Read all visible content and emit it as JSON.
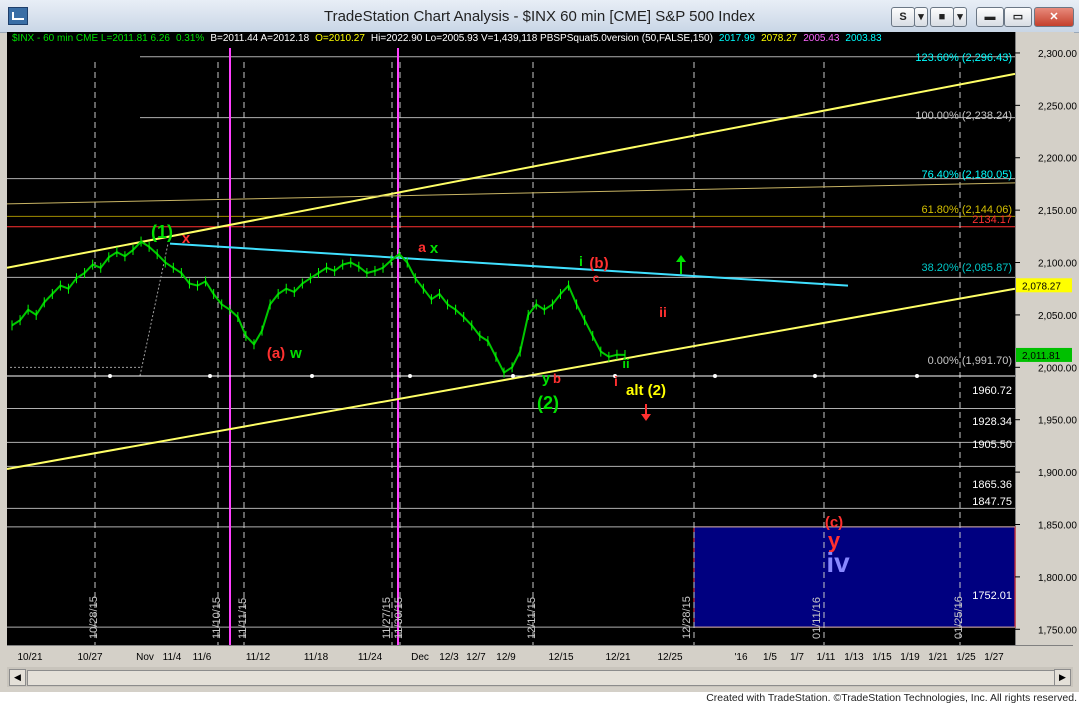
{
  "window": {
    "title": "TradeStation Chart Analysis - $INX 60 min [CME] S&P 500 Index"
  },
  "titlebar_buttons": {
    "s": "S",
    "dropdown": "▾",
    "stop": "■",
    "minimize": "▬",
    "maximize": "▭",
    "close": "✕"
  },
  "status_bar": [
    {
      "text": "$INX - 60 min  CME  L=2011.81  6.26",
      "color": "#00e000"
    },
    {
      "text": "0.31%",
      "color": "#00e000"
    },
    {
      "text": "B=2011.44  A=2012.18",
      "color": "#ffffff"
    },
    {
      "text": "O=2010.27",
      "color": "#ffff00"
    },
    {
      "text": "Hi=2022.90  Lo=2005.93  V=1,439,118  PBSPSquat5.0version (50,FALSE,150)",
      "color": "#ffffff"
    },
    {
      "text": "2017.99",
      "color": "#00ffff"
    },
    {
      "text": "2078.27",
      "color": "#ffff00"
    },
    {
      "text": "2005.43",
      "color": "#ff66ff"
    },
    {
      "text": "2003.83",
      "color": "#00ffff"
    }
  ],
  "price_axis": {
    "labels": [
      "2,300.00",
      "2,250.00",
      "2,200.00",
      "2,150.00",
      "2,100.00",
      "2,050.00",
      "2,000.00",
      "1,950.00",
      "1,900.00",
      "1,850.00",
      "1,800.00",
      "1,750.00"
    ],
    "highlights": [
      {
        "text": "2,078.27",
        "bg": "#ffff00",
        "fg": "#000000"
      },
      {
        "text": "2,011.81",
        "bg": "#00c000",
        "fg": "#000000"
      }
    ]
  },
  "fib_labels": [
    {
      "text": "123.60% (2,296.43)",
      "color": "#00ffff"
    },
    {
      "text": "100.00% (2,238.24)",
      "color": "#c8c8c8"
    },
    {
      "text": "76.40% (2,180.05)",
      "color": "#00ffff"
    },
    {
      "text": "61.80% (2,144.06)",
      "color": "#d4c000"
    },
    {
      "text": "38.20% (2,085.87)",
      "color": "#00c8c8"
    },
    {
      "text": "0.00% (1,991.70)",
      "color": "#c8c8c8"
    }
  ],
  "level_labels": [
    "2134.17",
    "1960.72",
    "1928.34",
    "1905.50",
    "1865.36",
    "1847.75",
    "1752.01"
  ],
  "time_axis": [
    "10/21",
    "10/27",
    "Nov",
    "11/4",
    "11/6",
    "11/12",
    "11/18",
    "11/24",
    "Dec",
    "12/3",
    "12/7",
    "12/9",
    "12/15",
    "12/21",
    "12/25",
    "'16",
    "1/5",
    "1/7",
    "1/11",
    "1/13",
    "1/15",
    "1/19",
    "1/21",
    "1/25",
    "1/27"
  ],
  "vertical_dates": [
    "10/28/15",
    "11/10/15",
    "11/11/15",
    "11/27/15",
    "11/30/15",
    "12/11/15",
    "12/28/15",
    "01/11/16",
    "01/25/16"
  ],
  "wave_labels": [
    {
      "text": "(1)",
      "color": "#00e000"
    },
    {
      "text": "x",
      "color": "#ff3030"
    },
    {
      "text": "(a)",
      "color": "#ff3030"
    },
    {
      "text": "w",
      "color": "#00e000"
    },
    {
      "text": "a",
      "color": "#ff3030"
    },
    {
      "text": "x",
      "color": "#00e000"
    },
    {
      "text": "i",
      "color": "#00e000"
    },
    {
      "text": "(b)",
      "color": "#ff3030"
    },
    {
      "text": "c",
      "color": "#ff3030"
    },
    {
      "text": "y",
      "color": "#00e000"
    },
    {
      "text": "b",
      "color": "#ff3030"
    },
    {
      "text": "(2)",
      "color": "#00e000"
    },
    {
      "text": "i",
      "color": "#ff3030"
    },
    {
      "text": "ii",
      "color": "#00e000"
    },
    {
      "text": "ii",
      "color": "#ff3030"
    },
    {
      "text": "alt (2)",
      "color": "#ffff00"
    },
    {
      "text": "(c)",
      "color": "#ff3030"
    },
    {
      "text": "y",
      "color": "#ff3030"
    },
    {
      "text": "iv",
      "color": "#8888ff"
    }
  ],
  "footer": "Created with TradeStation. ©TradeStation Technologies, Inc. All rights reserved.",
  "chart_data": {
    "type": "line",
    "ylim": [
      1735,
      2320
    ],
    "price_series": [
      2040,
      2045,
      2055,
      2050,
      2062,
      2070,
      2078,
      2075,
      2085,
      2090,
      2098,
      2095,
      2105,
      2110,
      2106,
      2112,
      2120,
      2115,
      2108,
      2100,
      2095,
      2090,
      2080,
      2078,
      2082,
      2070,
      2060,
      2055,
      2048,
      2030,
      2022,
      2035,
      2060,
      2070,
      2075,
      2072,
      2080,
      2085,
      2090,
      2095,
      2092,
      2098,
      2100,
      2096,
      2090,
      2092,
      2095,
      2102,
      2108,
      2100,
      2085,
      2075,
      2065,
      2070,
      2060,
      2055,
      2048,
      2040,
      2030,
      2025,
      2010,
      1995,
      2000,
      2015,
      2050,
      2060,
      2055,
      2060,
      2070,
      2078,
      2060,
      2045,
      2030,
      2015,
      2010,
      2012,
      2011.81
    ],
    "upper_channel": [
      2095,
      2280
    ],
    "lower_channel": [
      1903,
      2075
    ],
    "descending_line": [
      2118,
      2078
    ],
    "horizontal_levels": [
      2296.43,
      2238.24,
      2180.05,
      2144.06,
      2134.17,
      2085.87,
      1991.7,
      1960.72,
      1928.34,
      1905.5,
      1865.36,
      1847.75,
      1752.01
    ],
    "target_box": [
      1752.01,
      1847.75
    ]
  }
}
